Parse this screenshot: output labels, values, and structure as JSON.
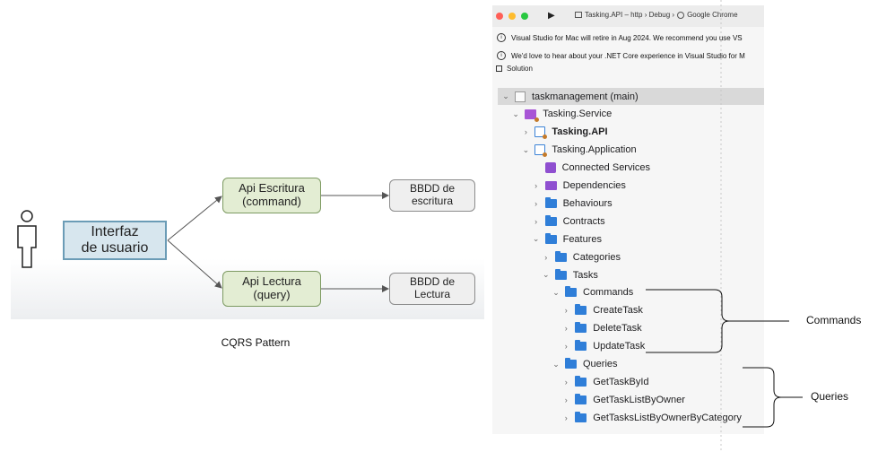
{
  "diagram": {
    "user_icon": "person-icon",
    "ui_box": "Interfaz\nde usuario",
    "api_write": "Api Escritura\n(command)",
    "api_read": "Api Lectura\n(query)",
    "db_write": "BBDD de\nescritura",
    "db_read": "BBDD de\nLectura",
    "caption": "CQRS Pattern"
  },
  "ide": {
    "run_target": "Tasking.API – http › Debug › ",
    "browser": "Google Chrome",
    "info_1": "Visual Studio for Mac will retire in Aug 2024. We recommend you use VS",
    "info_2": "We'd love to hear about your .NET Core experience in Visual Studio for M",
    "pad_title": "Solution",
    "tree": [
      {
        "label": "taskmanagement  (main)",
        "depth": 0,
        "chevron": "down",
        "icon": "solution-icon",
        "selected": true
      },
      {
        "label": "Tasking.Service",
        "depth": 1,
        "chevron": "down",
        "icon": "solution-folder-icon"
      },
      {
        "label": "Tasking.API",
        "depth": 2,
        "chevron": "right",
        "icon": "project-icon",
        "bold": true
      },
      {
        "label": "Tasking.Application",
        "depth": 2,
        "chevron": "down",
        "icon": "project-icon"
      },
      {
        "label": "Connected Services",
        "depth": 3,
        "chevron": "",
        "icon": "connected-services-icon"
      },
      {
        "label": "Dependencies",
        "depth": 3,
        "chevron": "right",
        "icon": "dependencies-icon"
      },
      {
        "label": "Behaviours",
        "depth": 3,
        "chevron": "right",
        "icon": "folder-icon"
      },
      {
        "label": "Contracts",
        "depth": 3,
        "chevron": "right",
        "icon": "folder-icon"
      },
      {
        "label": "Features",
        "depth": 3,
        "chevron": "down",
        "icon": "folder-icon"
      },
      {
        "label": "Categories",
        "depth": 4,
        "chevron": "right",
        "icon": "folder-icon"
      },
      {
        "label": "Tasks",
        "depth": 4,
        "chevron": "down",
        "icon": "folder-icon"
      },
      {
        "label": "Commands",
        "depth": 5,
        "chevron": "down",
        "icon": "folder-icon"
      },
      {
        "label": "CreateTask",
        "depth": 6,
        "chevron": "right",
        "icon": "folder-icon"
      },
      {
        "label": "DeleteTask",
        "depth": 6,
        "chevron": "right",
        "icon": "folder-icon"
      },
      {
        "label": "UpdateTask",
        "depth": 6,
        "chevron": "right",
        "icon": "folder-icon"
      },
      {
        "label": "Queries",
        "depth": 5,
        "chevron": "down",
        "icon": "folder-icon"
      },
      {
        "label": "GetTaskById",
        "depth": 6,
        "chevron": "right",
        "icon": "folder-icon"
      },
      {
        "label": "GetTaskListByOwner",
        "depth": 6,
        "chevron": "right",
        "icon": "folder-icon"
      },
      {
        "label": "GetTasksListByOwnerByCategory",
        "depth": 6,
        "chevron": "right",
        "icon": "folder-icon"
      }
    ]
  },
  "annotations": {
    "commands": "Commands",
    "queries": "Queries"
  },
  "colors": {
    "folder": "#2f7ed8",
    "ui_box_fill": "#d7e6ee",
    "api_fill": "#e3edd3",
    "db_fill": "#efefef"
  }
}
